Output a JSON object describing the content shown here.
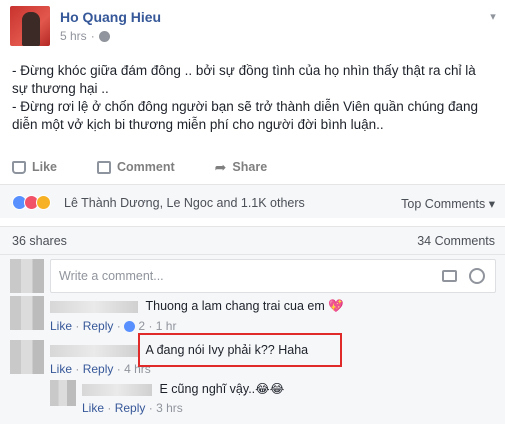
{
  "post": {
    "author": "Ho Quang Hieu",
    "time": "5 hrs",
    "lines": [
      "- Đừng khóc giữa đám đông .. bởi sự đồng tình của họ nhìn thấy thật ra chỉ là sự thương hại ..",
      "- Đừng rơi lệ ở chốn đông người bạn sẽ trở thành diễn Viên quần chúng đang diễn một vở kịch bi thương miễn phí cho người đời bình luận.."
    ]
  },
  "actions": {
    "like": "Like",
    "comment": "Comment",
    "share": "Share"
  },
  "reactions": {
    "summary": "Lê Thành Dương, Le Ngoc and 1.1K others",
    "sort": "Top Comments",
    "icons": [
      "like-reaction-icon",
      "love-reaction-icon",
      "sad-reaction-icon"
    ],
    "colors": {
      "like": "#5890ff",
      "love": "#f25268",
      "sad": "#f7b125"
    }
  },
  "counts": {
    "shares": "36 shares",
    "comments": "34 Comments"
  },
  "composer": {
    "placeholder": "Write a comment..."
  },
  "comments": [
    {
      "text": "Thuong a lam chang trai cua em 💖",
      "like": "Like",
      "reply": "Reply",
      "likes": "2",
      "time": "1 hr"
    },
    {
      "text": "A đang nói Ivy phải k?? Haha",
      "like": "Like",
      "reply": "Reply",
      "time": "4 hrs"
    },
    {
      "text": "E cũng nghĩ vậy..😂😂",
      "like": "Like",
      "reply": "Reply",
      "time": "3 hrs"
    }
  ]
}
